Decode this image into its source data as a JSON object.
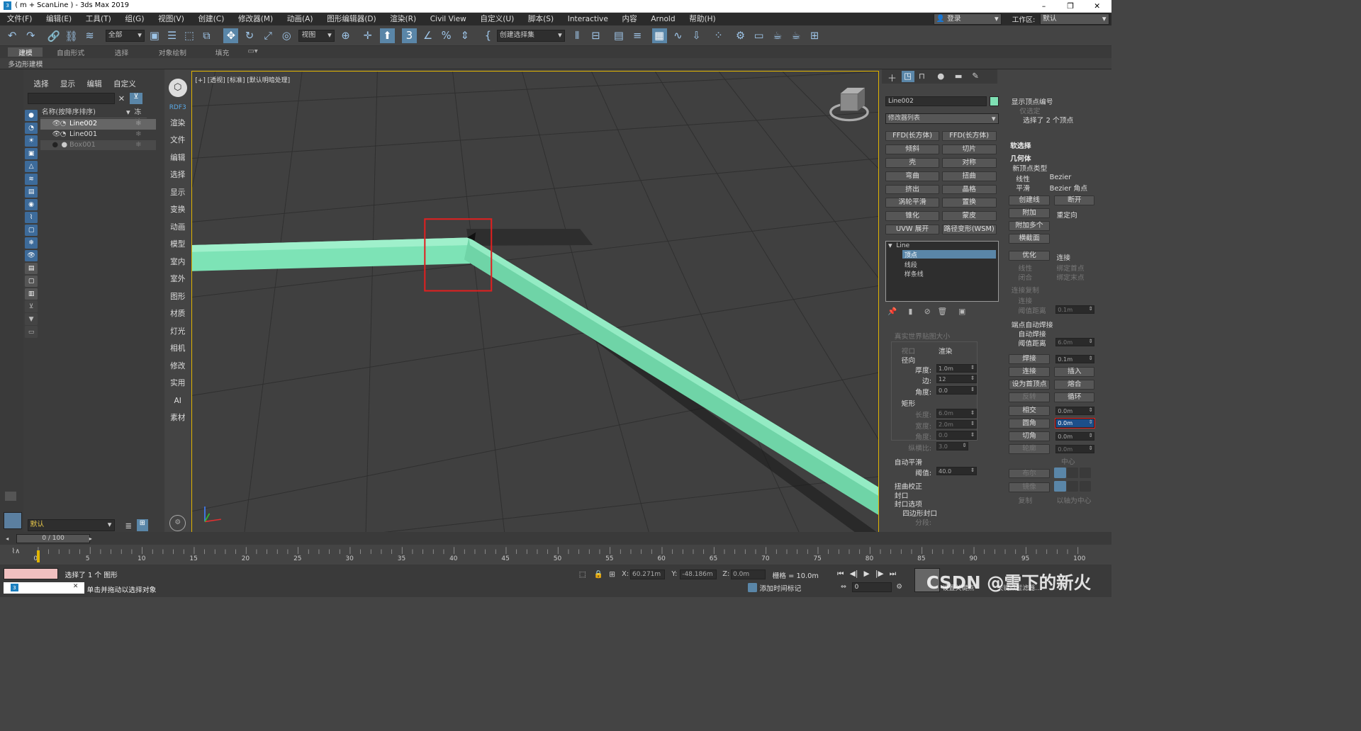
{
  "window": {
    "title": "( m + ScanLine ) - 3ds Max 2019",
    "minimize": "–",
    "maximize": "❐",
    "close": "✕"
  },
  "menu": [
    "文件(F)",
    "编辑(E)",
    "工具(T)",
    "组(G)",
    "视图(V)",
    "创建(C)",
    "修改器(M)",
    "动画(A)",
    "图形编辑器(D)",
    "渲染(R)",
    "Civil View",
    "自定义(U)",
    "脚本(S)",
    "Interactive",
    "内容",
    "Arnold",
    "帮助(H)"
  ],
  "account": {
    "login": "登录",
    "workspace_label": "工作区:",
    "workspace_value": "默认"
  },
  "toolbar": {
    "selection_filter": "全部",
    "ref_coord": "视图",
    "named_selection": "创建选择集"
  },
  "ribbon": {
    "tabs": [
      "建模",
      "自由形式",
      "选择",
      "对象绘制",
      "填充"
    ],
    "sub": "多边形建模"
  },
  "scene_explorer": {
    "menu": [
      "选择",
      "显示",
      "编辑",
      "自定义"
    ],
    "col_name": "名称(按降序排序)",
    "col_freeze": "冻结",
    "items": [
      {
        "name": "Line002",
        "selected": true
      },
      {
        "name": "Line001",
        "selected": false
      },
      {
        "name": "Box001",
        "selected": false
      }
    ],
    "layer": "默认"
  },
  "command_strip": [
    "RDF3",
    "渲染",
    "文件",
    "编辑",
    "选择",
    "显示",
    "变换",
    "动画",
    "模型",
    "室内",
    "室外",
    "图形",
    "材质",
    "灯光",
    "相机",
    "修改",
    "实用",
    "AI",
    "素材"
  ],
  "viewport": {
    "label": "[+] [透视] [标准] [默认明暗处理]"
  },
  "modify_panel": {
    "object_name": "Line002",
    "object_color": "#7fe0b4",
    "modifier_list": "修改器列表",
    "modifier_buttons": [
      "FFD(长方体)",
      "FFD(长方体)",
      "倾斜",
      "切片",
      "壳",
      "对称",
      "弯曲",
      "扭曲",
      "挤出",
      "晶格",
      "涡轮平滑",
      "置换",
      "锥化",
      "蒙皮",
      "UVW 展开",
      "路径变形(WSM)"
    ],
    "stack": {
      "root": "Line",
      "items": [
        "顶点",
        "线段",
        "样条线"
      ],
      "active": "顶点"
    },
    "render": {
      "real_world": "真实世界贴图大小",
      "viewport": "视口",
      "render": "渲染",
      "radial": "径向",
      "thickness_label": "厚度:",
      "thickness": "1.0m",
      "sides_label": "边:",
      "sides": "12",
      "angle_label": "角度:",
      "angle": "0.0",
      "rectangular": "矩形",
      "length_label": "长度:",
      "length": "6.0m",
      "width_label": "宽度:",
      "width": "2.0m",
      "angle2_label": "角度:",
      "angle2": "0.0",
      "aspect_label": "纵横比:",
      "aspect": "3.0",
      "auto_smooth": "自动平滑",
      "threshold_label": "阈值:",
      "threshold": "40.0",
      "twist_correct": "扭曲校正",
      "cap": "封口",
      "cap_options": "封口选项",
      "quad_cap": "四边形封口",
      "segments": "分段:"
    },
    "selection": {
      "show_vertex_numbers": "显示顶点编号",
      "selected_only": "仅选定",
      "selected_info": "选择了 2 个顶点"
    },
    "soft_selection": "软选择",
    "geometry": {
      "title": "几何体",
      "new_vertex_type": "新顶点类型",
      "linear": "线性",
      "bezier": "Bezier",
      "smooth": "平滑",
      "bezier_corner": "Bezier 角点",
      "create_line": "创建线",
      "break": "断开",
      "attach": "附加",
      "reorient": "重定向",
      "attach_multiple": "附加多个",
      "cross_section": "横截面",
      "refine": "优化",
      "connect": "连接",
      "linear2": "线性",
      "bind_first": "绑定首点",
      "closed": "闭合",
      "bind_last": "绑定末点",
      "connect_copy": "连接复制",
      "connect2": "连接",
      "threshold_dist": "阈值距离",
      "threshold_dist_value": "0.1m",
      "end_point_weld": "端点自动焊接",
      "auto_weld": "自动焊接",
      "weld_threshold": "阈值距离",
      "weld_threshold_value": "6.0m",
      "weld": "焊接",
      "weld_value": "0.1m",
      "connect3": "连接",
      "insert": "插入",
      "make_first": "设为首顶点",
      "fuse": "熔合",
      "reverse": "反转",
      "cycle": "循环",
      "cross_insert": "相交",
      "cross_value": "0.0m",
      "fillet": "圆角",
      "fillet_value": "0.0m",
      "chamfer": "切角",
      "chamfer_value": "0.0m",
      "outline": "轮廓",
      "outline_value": "0.0m",
      "center": "中心",
      "boolean": "布尔",
      "mirror": "镜像",
      "copy": "复制",
      "about_pivot": "以轴为中心"
    }
  },
  "timeline": {
    "frame": "0 / 100",
    "ticks": [
      "0",
      "5",
      "10",
      "15",
      "20",
      "25",
      "30",
      "35",
      "40",
      "45",
      "50",
      "55",
      "60",
      "65",
      "70",
      "75",
      "80",
      "85",
      "90",
      "95",
      "100"
    ]
  },
  "status": {
    "selected": "选择了 1 个 图形",
    "hint": "单击并拖动以选择对象",
    "x_label": "X:",
    "x": "60.271m",
    "y_label": "Y:",
    "y": "-48.186m",
    "z_label": "Z:",
    "z": "0.0m",
    "grid": "栅格 = 10.0m",
    "add_time_tag": "添加时间标记",
    "frame_field": "0",
    "set_key": "设置关键点",
    "key_filter": "关键点过滤器...",
    "watermark": "CSDN @雪下的新火"
  }
}
